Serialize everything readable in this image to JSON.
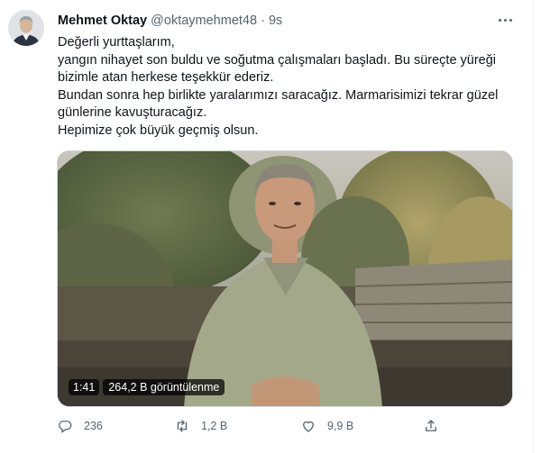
{
  "tweet": {
    "author_name": "Mehmet Oktay",
    "author_handle": "@oktaymehmet48",
    "separator": "·",
    "timestamp": "9s",
    "lines": [
      "Değerli yurttaşlarım,",
      "yangın nihayet son buldu ve soğutma çalışmaları başladı. Bu süreçte yüreği bizimle atan herkese teşekkür ederiz.",
      "Bundan sonra hep birlikte yaralarımızı saracağız. Marmarisimizi tekrar güzel günlerine kavuşturacağız.",
      "Hepimize çok büyük geçmiş olsun."
    ],
    "video": {
      "duration": "1:41",
      "views": "264,2 B görüntülenme"
    },
    "actions": {
      "replies": "236",
      "retweets": "1,2 B",
      "likes": "9,9 B"
    },
    "icons": [
      "more-icon",
      "reply-icon",
      "retweet-icon",
      "like-icon",
      "share-icon"
    ]
  },
  "colors": {
    "text": "#0f1419",
    "secondary": "#536471",
    "border": "#cfd9de"
  }
}
